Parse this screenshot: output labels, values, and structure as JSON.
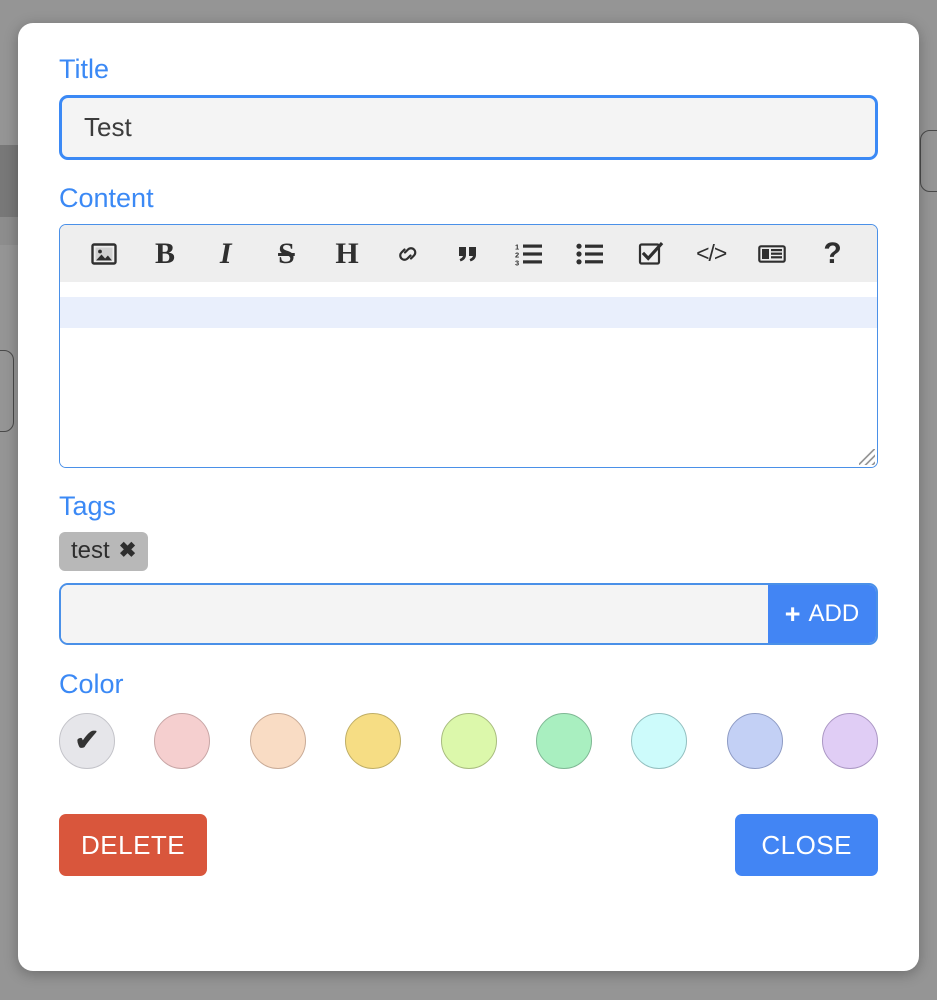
{
  "dialog": {
    "name": "note-editor-dialog",
    "fields": {
      "title": {
        "label": "Title",
        "value": "Test",
        "placeholder": ""
      },
      "content": {
        "label": "Content",
        "value": "",
        "placeholder": ""
      },
      "tags": {
        "label": "Tags",
        "input_value": "",
        "input_placeholder": "",
        "add_label": "ADD",
        "add_icon": "plus-icon",
        "chips": [
          {
            "label": "test",
            "remove_icon": "✖"
          }
        ]
      },
      "color": {
        "label": "Color"
      }
    },
    "toolbar": [
      {
        "name": "insert-image",
        "icon": "image-icon",
        "glyph": ""
      },
      {
        "name": "bold",
        "icon": "bold-icon",
        "glyph": "B"
      },
      {
        "name": "italic",
        "icon": "italic-icon",
        "glyph": "I"
      },
      {
        "name": "strikethrough",
        "icon": "strikethrough-icon",
        "glyph": "S"
      },
      {
        "name": "heading",
        "icon": "heading-icon",
        "glyph": "H"
      },
      {
        "name": "link",
        "icon": "link-icon",
        "glyph": ""
      },
      {
        "name": "quote",
        "icon": "quote-icon",
        "glyph": "”"
      },
      {
        "name": "ordered-list",
        "icon": "ordered-list-icon",
        "glyph": ""
      },
      {
        "name": "unordered-list",
        "icon": "unordered-list-icon",
        "glyph": ""
      },
      {
        "name": "task-list",
        "icon": "checkbox-icon",
        "glyph": ""
      },
      {
        "name": "code",
        "icon": "code-icon",
        "glyph": "</>"
      },
      {
        "name": "article",
        "icon": "newspaper-icon",
        "glyph": ""
      },
      {
        "name": "help",
        "icon": "question-mark-icon",
        "glyph": "?"
      }
    ],
    "colors": [
      {
        "name": "default",
        "hex": "#e6e6ea",
        "border": "#c3c3c9",
        "selected": true,
        "check": "✔"
      },
      {
        "name": "red",
        "hex": "#f5cfcf",
        "border": "#c8a6a6",
        "selected": false,
        "check": ""
      },
      {
        "name": "orange",
        "hex": "#f9dcc4",
        "border": "#c9ab97",
        "selected": false,
        "check": ""
      },
      {
        "name": "yellow",
        "hex": "#f6dd84",
        "border": "#bfae66",
        "selected": false,
        "check": ""
      },
      {
        "name": "lime",
        "hex": "#dcf8ab",
        "border": "#a8bc7f",
        "selected": false,
        "check": ""
      },
      {
        "name": "green",
        "hex": "#a9efc0",
        "border": "#7fb894",
        "selected": false,
        "check": ""
      },
      {
        "name": "cyan",
        "hex": "#cdfbfb",
        "border": "#93bfbf",
        "selected": false,
        "check": ""
      },
      {
        "name": "blue",
        "hex": "#c3d0f5",
        "border": "#8e9bc4",
        "selected": false,
        "check": ""
      },
      {
        "name": "purple",
        "hex": "#e0cdf5",
        "border": "#ab97c4",
        "selected": false,
        "check": ""
      }
    ],
    "footer": {
      "delete_label": "DELETE",
      "close_label": "CLOSE",
      "delete_color": "#d9563c",
      "close_color": "#4285f4"
    }
  },
  "theme": {
    "accent": "#3b89f5",
    "label_color": "#3b89f5",
    "backdrop": "#959595"
  }
}
